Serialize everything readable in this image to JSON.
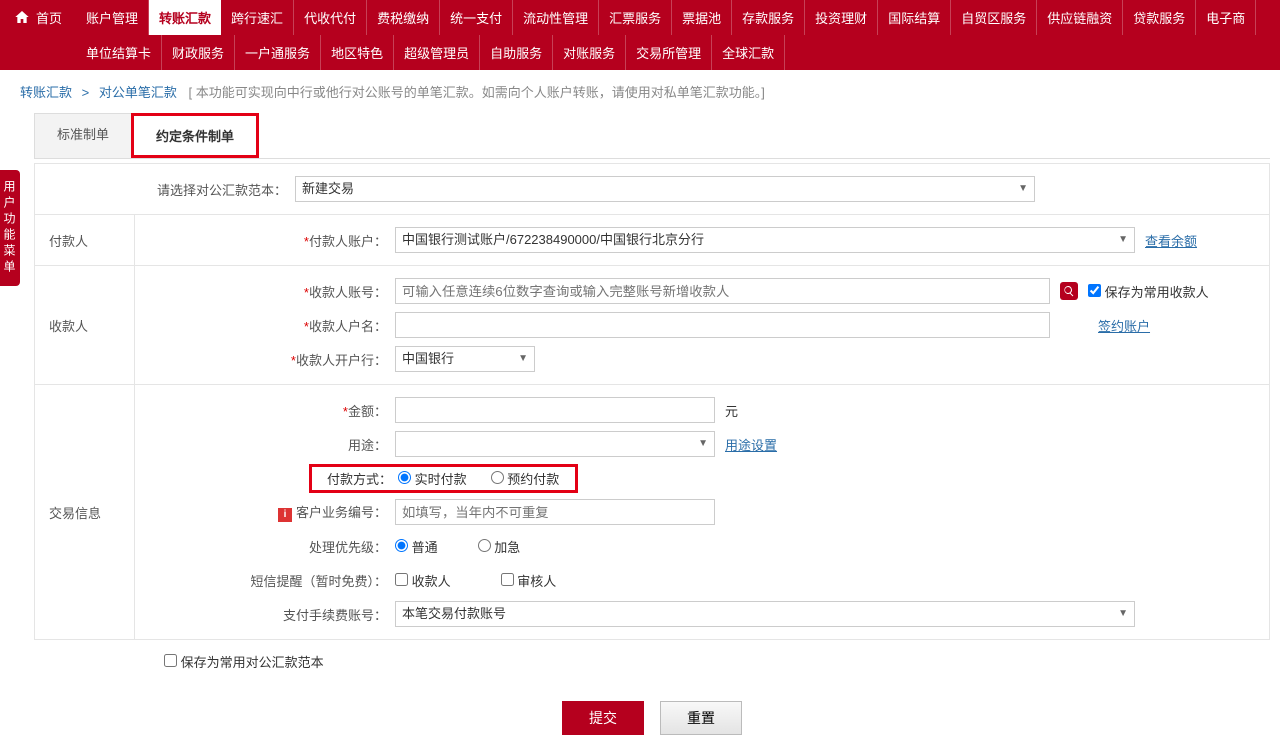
{
  "home": "首页",
  "nav": {
    "row1": [
      "账户管理",
      "转账汇款",
      "跨行速汇",
      "代收代付",
      "费税缴纳",
      "统一支付",
      "流动性管理",
      "汇票服务",
      "票据池",
      "存款服务",
      "投资理财",
      "国际结算",
      "自贸区服务",
      "供应链融资",
      "贷款服务",
      "电子商"
    ],
    "row2": [
      "单位结算卡",
      "财政服务",
      "一户通服务",
      "地区特色",
      "超级管理员",
      "自助服务",
      "对账服务",
      "交易所管理",
      "全球汇款"
    ],
    "activeIdx": 1
  },
  "breadcrumb": {
    "a": "转账汇款",
    "b": "对公单笔汇款",
    "hint": "[ 本功能可实现向中行或他行对公账号的单笔汇款。如需向个人账户转账，请使用对私单笔汇款功能。]"
  },
  "sideTab": "用户功能菜单",
  "tabs": {
    "t1": "标准制单",
    "t2": "约定条件制单"
  },
  "form": {
    "templateLabel": "请选择对公汇款范本：",
    "templateValue": "新建交易",
    "payer": {
      "section": "付款人",
      "acctLabel": "付款人账户：",
      "acctValue": "中国银行测试账户/672238490000/中国银行北京分行",
      "balanceLink": "查看余额"
    },
    "payee": {
      "section": "收款人",
      "acctLabel": "收款人账号：",
      "acctPlaceholder": "可输入任意连续6位数字查询或输入完整账号新增收款人",
      "saveCommon": "保存为常用收款人",
      "contractLink": "签约账户",
      "nameLabel": "收款人户名：",
      "bankLabel": "收款人开户行：",
      "bankValue": "中国银行"
    },
    "txn": {
      "section": "交易信息",
      "amountLabel": "金额：",
      "amountUnit": "元",
      "purposeLabel": "用途：",
      "purposeLink": "用途设置",
      "payMethodLabel": "付款方式：",
      "payMethodOpt1": "实时付款",
      "payMethodOpt2": "预约付款",
      "bizNoLabel": "客户业务编号：",
      "bizNoPlaceholder": "如填写，当年内不可重复",
      "priorityLabel": "处理优先级：",
      "priorityOpt1": "普通",
      "priorityOpt2": "加急",
      "smsLabel": "短信提醒（暂时免费）：",
      "smsOpt1": "收款人",
      "smsOpt2": "审核人",
      "feeAcctLabel": "支付手续费账号：",
      "feeAcctValue": "本笔交易付款账号"
    },
    "saveTemplate": "保存为常用对公汇款范本"
  },
  "buttons": {
    "submit": "提交",
    "reset": "重置"
  }
}
